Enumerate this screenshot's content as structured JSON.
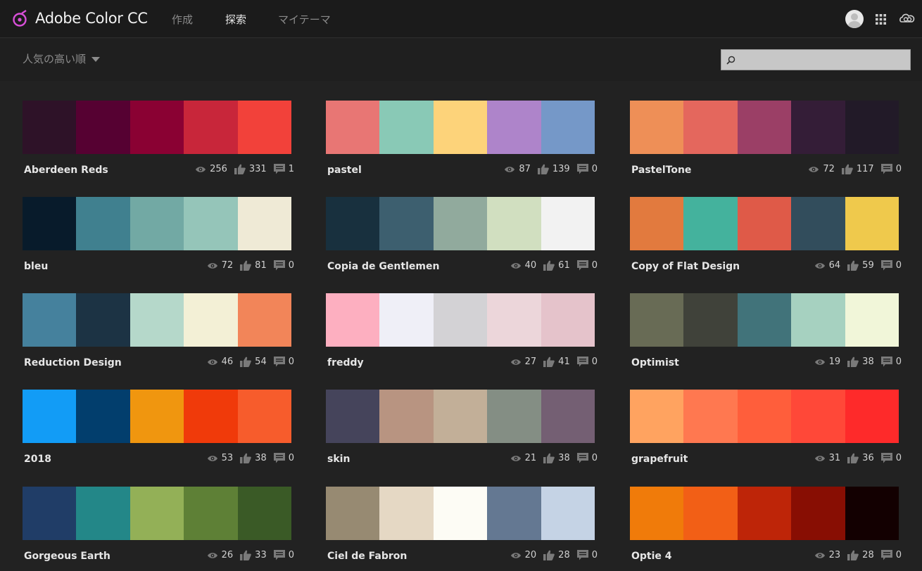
{
  "header": {
    "app_title": "Adobe Color CC",
    "nav": [
      {
        "label": "作成",
        "active": false
      },
      {
        "label": "探索",
        "active": true
      },
      {
        "label": "マイテーマ",
        "active": false
      }
    ]
  },
  "toolbar": {
    "sort_label": "人気の高い順",
    "search_value": "",
    "search_placeholder": ""
  },
  "icons": {
    "views": "eye-icon",
    "likes": "thumbs-up-icon",
    "comments": "comment-icon"
  },
  "themes": [
    {
      "name": "Aberdeen Reds",
      "views": "256",
      "likes": "331",
      "comments": "1",
      "colors": [
        "#2e1228",
        "#560132",
        "#8a0133",
        "#c8263a",
        "#f2413a"
      ]
    },
    {
      "name": "pastel",
      "views": "87",
      "likes": "139",
      "comments": "0",
      "colors": [
        "#e87674",
        "#89c9b6",
        "#fdd37a",
        "#ae84ca",
        "#7598c8"
      ]
    },
    {
      "name": "PastelTone",
      "views": "72",
      "likes": "117",
      "comments": "0",
      "colors": [
        "#ee8f57",
        "#e4675d",
        "#9b3f66",
        "#341d37",
        "#221a28"
      ]
    },
    {
      "name": "bleu",
      "views": "72",
      "likes": "81",
      "comments": "0",
      "colors": [
        "#081b2b",
        "#40808f",
        "#72a9a4",
        "#95c5b9",
        "#efead6"
      ]
    },
    {
      "name": "Copia de Gentlemen",
      "views": "40",
      "likes": "61",
      "comments": "0",
      "colors": [
        "#18303e",
        "#3d5f6f",
        "#91aa9d",
        "#d1dfc0",
        "#f2f2f2"
      ]
    },
    {
      "name": "Copy of Flat Design",
      "views": "64",
      "likes": "59",
      "comments": "0",
      "colors": [
        "#e27a3e",
        "#44b29d",
        "#df5a48",
        "#324d5c",
        "#efc94c"
      ]
    },
    {
      "name": "Reduction Design",
      "views": "46",
      "likes": "54",
      "comments": "0",
      "colors": [
        "#45819d",
        "#1c3344",
        "#b5d8ca",
        "#f3f0d6",
        "#f28559"
      ]
    },
    {
      "name": "freddy",
      "views": "27",
      "likes": "41",
      "comments": "0",
      "colors": [
        "#fdafc0",
        "#efeff7",
        "#d3d2d5",
        "#ecd6da",
        "#e5c3cb"
      ]
    },
    {
      "name": "Optimist",
      "views": "19",
      "likes": "38",
      "comments": "0",
      "colors": [
        "#686b55",
        "#40423a",
        "#41737a",
        "#a6d1c0",
        "#f1f6d9"
      ]
    },
    {
      "name": "2018",
      "views": "53",
      "likes": "38",
      "comments": "0",
      "colors": [
        "#129cf6",
        "#023e6d",
        "#f0960f",
        "#f03a0a",
        "#f75c2c"
      ]
    },
    {
      "name": "skin",
      "views": "21",
      "likes": "38",
      "comments": "0",
      "colors": [
        "#45445b",
        "#b89481",
        "#c2af98",
        "#848e84",
        "#745f73"
      ]
    },
    {
      "name": "grapefruit",
      "views": "31",
      "likes": "36",
      "comments": "0",
      "colors": [
        "#ffa360",
        "#ff7850",
        "#ff5e3b",
        "#ff4838",
        "#fe2a2a"
      ]
    },
    {
      "name": "Gorgeous Earth",
      "views": "26",
      "likes": "33",
      "comments": "0",
      "colors": [
        "#203d67",
        "#238788",
        "#93b057",
        "#5e8036",
        "#3a5a26"
      ]
    },
    {
      "name": "Ciel de Fabron",
      "views": "20",
      "likes": "28",
      "comments": "0",
      "colors": [
        "#978a72",
        "#e5d8c4",
        "#fdfcf5",
        "#647892",
        "#c5d3e5"
      ]
    },
    {
      "name": "Optie 4",
      "views": "23",
      "likes": "28",
      "comments": "0",
      "colors": [
        "#f07b0a",
        "#f25f16",
        "#be2508",
        "#880e03",
        "#130001"
      ]
    }
  ]
}
